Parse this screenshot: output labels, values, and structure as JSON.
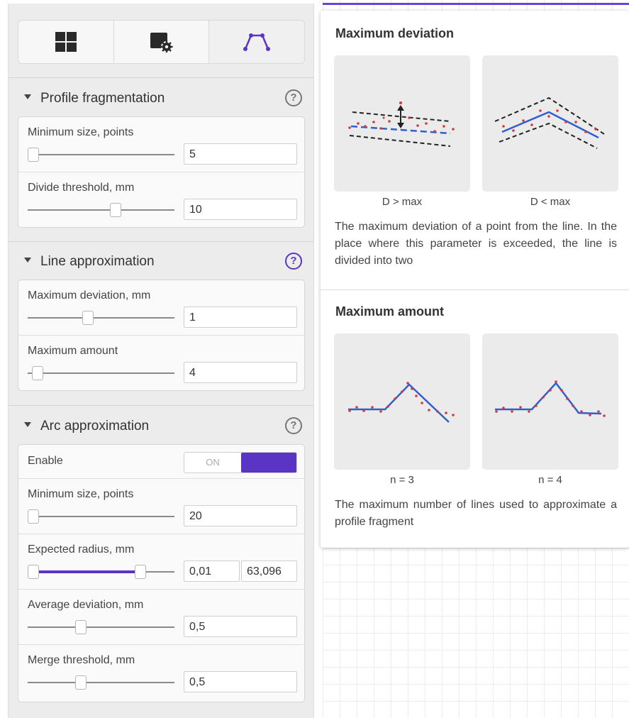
{
  "tabs": [
    {
      "icon": "grid-icon"
    },
    {
      "icon": "settings-screen-icon"
    },
    {
      "icon": "polyline-icon"
    }
  ],
  "sections": {
    "profile_fragmentation": {
      "title": "Profile fragmentation",
      "min_size": {
        "label": "Minimum size, points",
        "value": "5",
        "slider_fraction": 0.04
      },
      "divide_threshold": {
        "label": "Divide threshold, mm",
        "value": "10",
        "slider_fraction": 0.6
      }
    },
    "line_approximation": {
      "title": "Line approximation",
      "max_deviation": {
        "label": "Maximum deviation, mm",
        "value": "1",
        "slider_fraction": 0.41
      },
      "max_amount": {
        "label": "Maximum amount",
        "value": "4",
        "slider_fraction": 0.07
      }
    },
    "arc_approximation": {
      "title": "Arc approximation",
      "enable": {
        "label": "Enable",
        "toggle_text": "ON",
        "state": true
      },
      "min_size": {
        "label": "Minimum size, points",
        "value": "20",
        "slider_fraction": 0.04
      },
      "expected_radius": {
        "label": "Expected radius, mm",
        "value_min": "0,01",
        "value_max": "63,096",
        "range_low": 0.04,
        "range_high": 0.77
      },
      "average_deviation": {
        "label": "Average deviation, mm",
        "value": "0,5",
        "slider_fraction": 0.36
      },
      "merge_threshold": {
        "label": "Merge threshold, mm",
        "value": "0,5",
        "slider_fraction": 0.36
      }
    }
  },
  "help_popup": {
    "max_deviation": {
      "title": "Maximum deviation",
      "caption_left": "D > max",
      "caption_right": "D < max",
      "description": "The maximum deviation of a point from the line. In the place where this parameter is exceeded, the line is divided into two"
    },
    "max_amount": {
      "title": "Maximum amount",
      "caption_left": "n = 3",
      "caption_right": "n = 4",
      "description": "The maximum number of lines used to approximate a profile fragment"
    }
  },
  "colors": {
    "accent": "#5a35c5",
    "line_blue": "#2f5fd0",
    "point_red": "#d23b3b"
  }
}
